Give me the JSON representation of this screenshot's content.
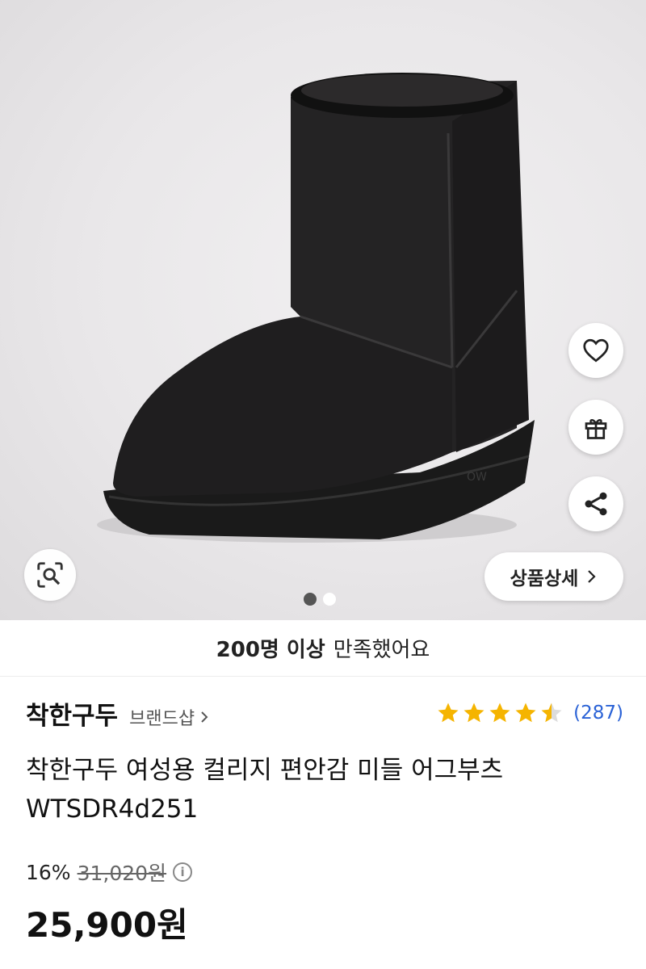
{
  "hero": {
    "detail_button_label": "상품상세",
    "carousel": {
      "count": 2,
      "active": 1
    }
  },
  "satisfaction": {
    "strong": "200명 이상",
    "rest": "만족했어요"
  },
  "brand": {
    "name": "착한구두",
    "shop_link": "브랜드샵"
  },
  "rating": {
    "value": 4.5,
    "max": 5,
    "count_label": "(287)",
    "star_color": "#f5b400"
  },
  "product": {
    "title": "착한구두 여성용 컬리지 편안감 미들 어그부츠 WTSDR4d251"
  },
  "price": {
    "discount": "16%",
    "original": "31,020원",
    "final": "25,900원"
  },
  "icons": [
    "heart-icon",
    "gift-icon",
    "share-icon",
    "image-search-icon",
    "chevron-right-icon",
    "info-icon",
    "star-icon"
  ]
}
